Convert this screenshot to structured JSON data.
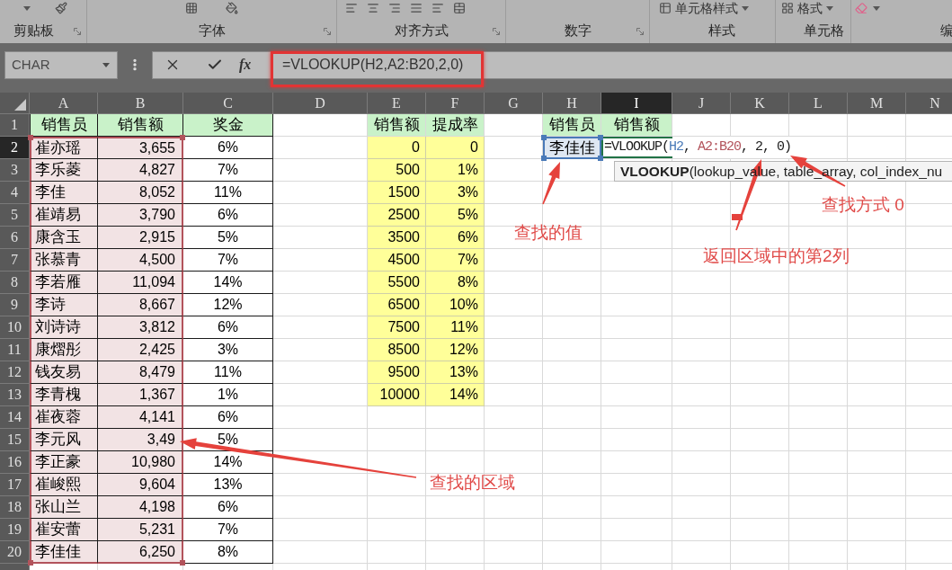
{
  "ribbon": {
    "groups": [
      {
        "label": "剪贴板",
        "launcher": true
      },
      {
        "label": "字体",
        "launcher": true
      },
      {
        "label": "对齐方式",
        "launcher": true
      },
      {
        "label": "数字",
        "launcher": true
      },
      {
        "label": "样式",
        "launcher": false,
        "buttons": [
          {
            "label": "单元格样式"
          }
        ]
      },
      {
        "label": "单元格",
        "launcher": false,
        "buttons": [
          {
            "label": "格式"
          }
        ]
      },
      {
        "label": "编",
        "launcher": false
      }
    ]
  },
  "formula_bar": {
    "name_box": "CHAR",
    "function_label": "fx",
    "formula": "=VLOOKUP(H2,A2:B20,2,0)",
    "outlined": true
  },
  "column_headers": [
    {
      "label": "A",
      "selected": false
    },
    {
      "label": "B",
      "selected": false
    },
    {
      "label": "C",
      "selected": false
    },
    {
      "label": "D",
      "selected": false
    },
    {
      "label": "E",
      "selected": false
    },
    {
      "label": "F",
      "selected": false
    },
    {
      "label": "G",
      "selected": false
    },
    {
      "label": "H",
      "selected": false
    },
    {
      "label": "I",
      "selected": true
    },
    {
      "label": "J",
      "selected": false
    },
    {
      "label": "K",
      "selected": false
    },
    {
      "label": "L",
      "selected": false
    },
    {
      "label": "M",
      "selected": false
    },
    {
      "label": "N",
      "selected": false
    }
  ],
  "row_headers": [
    {
      "label": "1",
      "selected": false
    },
    {
      "label": "2",
      "selected": true
    },
    {
      "label": "3",
      "selected": false
    },
    {
      "label": "4",
      "selected": false
    },
    {
      "label": "5",
      "selected": false
    },
    {
      "label": "6",
      "selected": false
    },
    {
      "label": "7",
      "selected": false
    },
    {
      "label": "8",
      "selected": false
    },
    {
      "label": "9",
      "selected": false
    },
    {
      "label": "10",
      "selected": false
    },
    {
      "label": "11",
      "selected": false
    },
    {
      "label": "12",
      "selected": false
    },
    {
      "label": "13",
      "selected": false
    },
    {
      "label": "14",
      "selected": false
    },
    {
      "label": "15",
      "selected": false
    },
    {
      "label": "16",
      "selected": false
    },
    {
      "label": "17",
      "selected": false
    },
    {
      "label": "18",
      "selected": false
    },
    {
      "label": "19",
      "selected": false
    },
    {
      "label": "20",
      "selected": false
    }
  ],
  "sales_table": {
    "columns": [
      "销售员",
      "销售额",
      "奖金"
    ],
    "rows": [
      [
        "崔亦瑶",
        "3,655",
        "6%"
      ],
      [
        "李乐菱",
        "4,827",
        "7%"
      ],
      [
        "李佳",
        "8,052",
        "11%"
      ],
      [
        "崔靖易",
        "3,790",
        "6%"
      ],
      [
        "康含玉",
        "2,915",
        "5%"
      ],
      [
        "张慕青",
        "4,500",
        "7%"
      ],
      [
        "李若雁",
        "11,094",
        "14%"
      ],
      [
        "李诗",
        "8,667",
        "12%"
      ],
      [
        "刘诗诗",
        "3,812",
        "6%"
      ],
      [
        "康熠彤",
        "2,425",
        "3%"
      ],
      [
        "钱友易",
        "8,479",
        "11%"
      ],
      [
        "李青槐",
        "1,367",
        "1%"
      ],
      [
        "崔夜蓉",
        "4,141",
        "6%"
      ],
      [
        "李元风",
        "3,49",
        "5%"
      ],
      [
        "李正豪",
        "10,980",
        "14%"
      ],
      [
        "崔峻熙",
        "9,604",
        "13%"
      ],
      [
        "张山兰",
        "4,198",
        "6%"
      ],
      [
        "崔安蕾",
        "5,231",
        "7%"
      ],
      [
        "李佳佳",
        "6,250",
        "8%"
      ]
    ]
  },
  "rate_table": {
    "columns": [
      "销售额",
      "提成率"
    ],
    "rows": [
      [
        "0",
        "0"
      ],
      [
        "500",
        "1%"
      ],
      [
        "1500",
        "3%"
      ],
      [
        "2500",
        "5%"
      ],
      [
        "3500",
        "6%"
      ],
      [
        "4500",
        "7%"
      ],
      [
        "5500",
        "8%"
      ],
      [
        "6500",
        "10%"
      ],
      [
        "7500",
        "11%"
      ],
      [
        "8500",
        "12%"
      ],
      [
        "9500",
        "13%"
      ],
      [
        "10000",
        "14%"
      ]
    ]
  },
  "lookup": {
    "columns": [
      "销售员",
      "销售额"
    ],
    "value": "李佳佳",
    "formula_cell": {
      "active": true,
      "parts": [
        {
          "kind": "text",
          "text": "=VLOOKUP("
        },
        {
          "kind": "cell_ref",
          "text": "H2",
          "color": "#4a7ab8"
        },
        {
          "kind": "text",
          "text": ", "
        },
        {
          "kind": "range_ref",
          "text": "A2:B20",
          "color": "#b2535b"
        },
        {
          "kind": "text",
          "text": ", 2, 0)"
        }
      ],
      "tooltip": "**VLOOKUP**(lookup_value, table_array, col_index_nu"
    }
  },
  "annotations": [
    {
      "text": "查找方式 0"
    },
    {
      "text": "查找的值"
    },
    {
      "text": "返回区域中的第2列"
    },
    {
      "text": "查找的区域"
    }
  ]
}
